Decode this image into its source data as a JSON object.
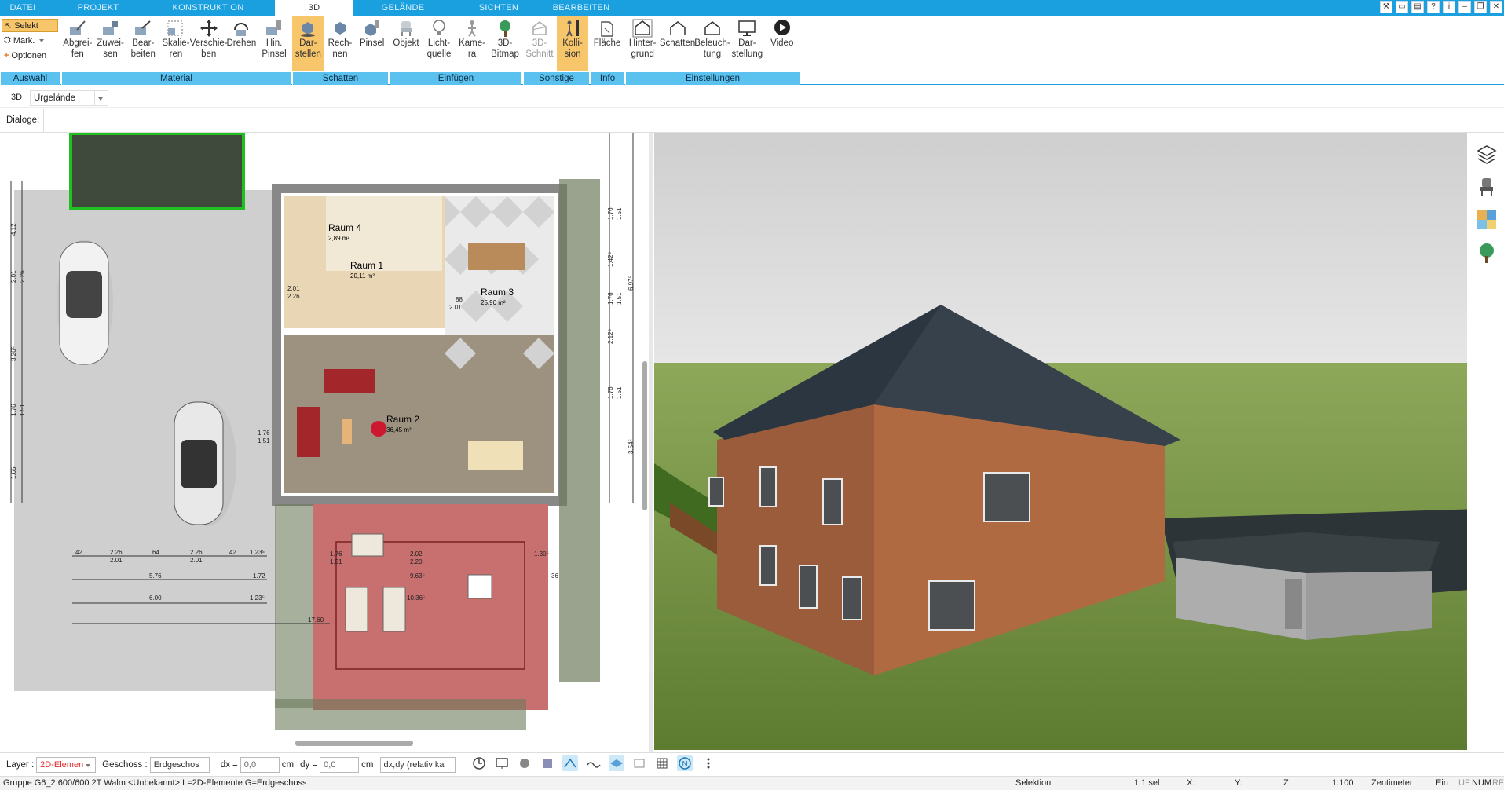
{
  "tabs": [
    "DATEI",
    "PROJEKT",
    "KONSTRUKTION",
    "3D",
    "GELÄNDE",
    "SICHTEN",
    "BEARBEITEN"
  ],
  "active_tab": "3D",
  "ribbon": {
    "auswahl": {
      "label": "Auswahl",
      "items": [
        "Selekt",
        "Mark.",
        "Optionen"
      ]
    },
    "material": {
      "label": "Material",
      "buttons": [
        "Abgrei-\nfen",
        "Zuwei-\nsen",
        "Bear-\nbeiten",
        "Skalie-\nren",
        "Verschie-\nben",
        "Drehen",
        "Hin.\nPinsel"
      ]
    },
    "schatten": {
      "label": "Schatten",
      "buttons": [
        "Dar-\nstellen",
        "Rech-\nnen",
        "Pinsel"
      ]
    },
    "einfuegen": {
      "label": "Einfügen",
      "buttons": [
        "Objekt",
        "Licht-\nquelle",
        "Kame-\nra",
        "3D-\nBitmap"
      ]
    },
    "sonstige": {
      "label": "Sonstige",
      "buttons": [
        "3D-\nSchnitt",
        "Kolli-\nsion"
      ]
    },
    "info": {
      "label": "Info",
      "buttons": [
        "Fläche"
      ]
    },
    "einstellungen": {
      "label": "Einstellungen",
      "buttons": [
        "Hinter-\ngrund",
        "Schatten",
        "Beleuch-\ntung",
        "Dar-\nstellung",
        "Video"
      ]
    }
  },
  "view": {
    "mode": "3D",
    "selection": "Urgelände"
  },
  "dialoge_label": "Dialoge:",
  "plan": {
    "rooms": [
      {
        "name": "Raum 4",
        "area": "2,89 m²"
      },
      {
        "name": "Raum 1",
        "area": "20,11 m²"
      },
      {
        "name": "Raum 3",
        "area": "25,90 m²"
      },
      {
        "name": "Raum 2",
        "area": "36,45 m²"
      }
    ],
    "dims_right": [
      "1.76",
      "1.51",
      "1.42⁵",
      "1.76",
      "1.51",
      "2.12⁵",
      "1.76",
      "1.51",
      "3.54⁵",
      "6.97⁵"
    ],
    "dims_bottom": [
      "42",
      "2.26",
      "2.01",
      "64",
      "2.26",
      "2.01",
      "42",
      "1.23⁵",
      "5.76",
      "1.72",
      "6.00",
      "1.23⁵",
      "17.60",
      "1.76",
      "1.51",
      "2.02",
      "2.20",
      "1.30⁵",
      "9.63⁵",
      "10.36⁵",
      "36"
    ],
    "dims_left": [
      "4.12",
      "2.01",
      "2.26",
      "3.26⁵",
      "1.76",
      "1.51",
      "1.65"
    ],
    "misc": [
      "2.01",
      "2.26",
      "1.76",
      "1.51",
      "88",
      "2.01"
    ]
  },
  "status": {
    "layer_label": "Layer :",
    "layer_value": "2D-Elemen",
    "geschoss_label": "Geschoss :",
    "geschoss_value": "Erdgeschos",
    "dx_label": "dx =",
    "dx_value": "0,0",
    "dx_unit": "cm",
    "dy_label": "dy =",
    "dy_value": "0,0",
    "dy_unit": "cm",
    "mode_value": "dx,dy (relativ ka"
  },
  "statusline": {
    "info": "Gruppe G6_2 600/600 2T Walm <Unbekannt> L=2D-Elemente G=Erdgeschoss",
    "selektion": "Selektion",
    "count": "1:1 sel",
    "x": "X:",
    "y": "Y:",
    "z": "Z:",
    "scale": "1:100",
    "unit": "Zentimeter",
    "ein": "Ein",
    "uf": "UF",
    "num": "NUM",
    "rf": "RF"
  },
  "colors": {
    "accent": "#1aa0de",
    "ribbon_label": "#5bc2ef",
    "active_btn": "#f7c56a",
    "wall": "#8b5a3c",
    "roof": "#2c3640",
    "grass": "#7ca04b"
  }
}
